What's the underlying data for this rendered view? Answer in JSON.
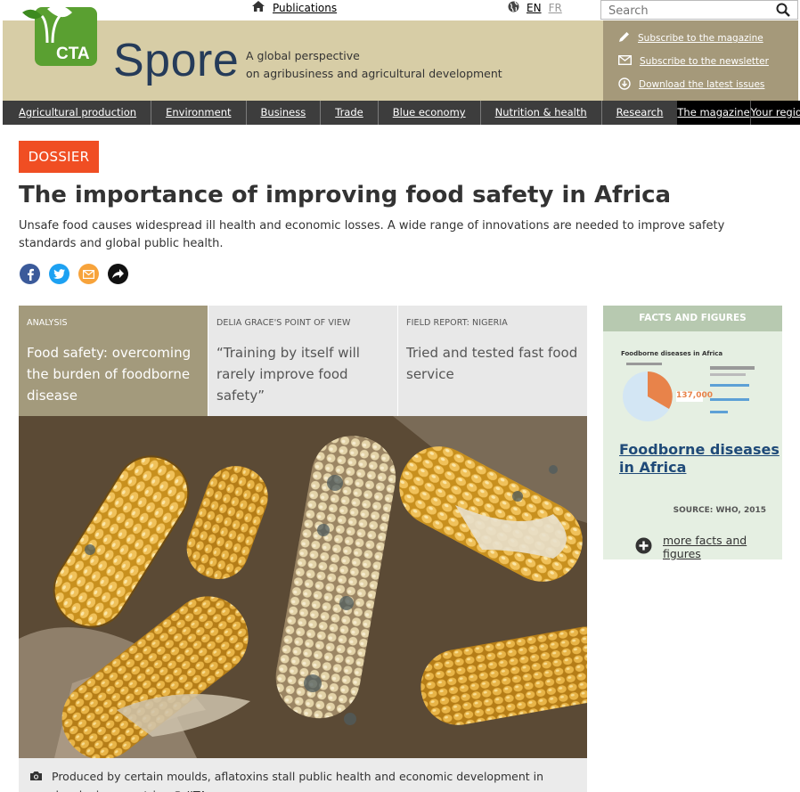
{
  "topbar": {
    "publications": "Publications",
    "lang_en": "EN",
    "lang_fr": "FR",
    "search_placeholder": "Search"
  },
  "header": {
    "logo_text": "CTA",
    "brand": "Spore",
    "tagline_1": "A global perspective",
    "tagline_2": "on agribusiness and agricultural development",
    "links": [
      {
        "label": "Subscribe to the magazine",
        "icon": "pencil-icon"
      },
      {
        "label": "Subscribe to the newsletter",
        "icon": "envelope-icon"
      },
      {
        "label": "Download the latest issues",
        "icon": "download-icon"
      }
    ]
  },
  "nav": {
    "items": [
      "Agricultural production",
      "Environment",
      "Business",
      "Trade",
      "Blue economy",
      "Nutrition & health",
      "Research"
    ],
    "magazine": "The magazine",
    "region": "Your region"
  },
  "article": {
    "badge": "DOSSIER",
    "title": "The importance of improving food safety in Africa",
    "lede": "Unsafe food causes widespread ill health and economic losses. A wide range of innovations are needed to improve safety standards and global public health."
  },
  "tabs": [
    {
      "kicker": "Analysis",
      "headline": "Food safety: overcoming the burden of foodborne disease"
    },
    {
      "kicker": "Delia Grace's point of view",
      "headline": "“Training by itself will rarely improve food safety”"
    },
    {
      "kicker": "Field report: Nigeria",
      "headline": "Tried and tested fast food service"
    }
  ],
  "photo": {
    "caption": "Produced by certain moulds, aflatoxins stall public health and economic development in developing countries © IITA"
  },
  "facts": {
    "header": "FACTS AND FIGURES",
    "infographic_title": "Foodborne diseases in Africa",
    "infographic_figure": "137,000",
    "title": "Foodborne diseases in Africa",
    "source": "SOURCE: WHO, 2015",
    "more": "more facts and figures"
  },
  "colors": {
    "header_bg": "#d7cda6",
    "header_links_bg": "#a5997a",
    "nav_bg": "#3d3d3d",
    "badge": "#f04e23",
    "brand": "#253b59",
    "tab_active": "#a39a7c",
    "facts_bg": "#e5efe2"
  }
}
